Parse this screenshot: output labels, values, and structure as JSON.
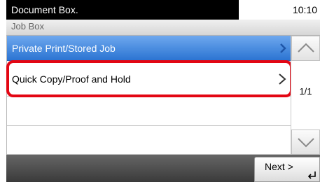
{
  "header": {
    "title": "Document Box.",
    "time": "10:10"
  },
  "subheader": {
    "label": "Job Box"
  },
  "list": {
    "items": [
      {
        "label": "Private Print/Stored Job",
        "selected": true
      },
      {
        "label": "Quick Copy/Proof and Hold",
        "highlighted": true
      },
      {
        "label": ""
      },
      {
        "label": ""
      }
    ]
  },
  "pager": {
    "indicator": "1/1",
    "up_icon": "chevron-up-icon",
    "down_icon": "chevron-down-icon"
  },
  "footer": {
    "next_label": "Next >",
    "enter_icon": "enter-return-icon"
  },
  "colors": {
    "selected_row": "#2b74d2",
    "highlight_outline": "#e30613",
    "footer": "#4a4a4a"
  }
}
